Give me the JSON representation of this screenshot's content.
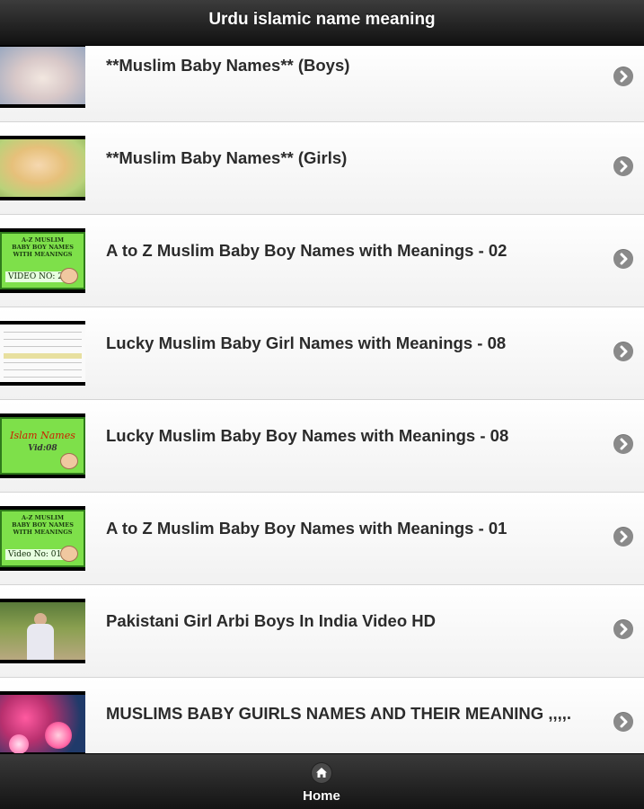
{
  "header": {
    "title": "Urdu islamic name meaning"
  },
  "items": [
    {
      "title": "**Muslim Baby Names** (Boys)",
      "thumb_icon": "sleeping-baby-thumbnail"
    },
    {
      "title": "**Muslim Baby Names** (Girls)",
      "thumb_icon": "baby-girl-thumbnail"
    },
    {
      "title": "A to Z Muslim Baby Boy Names with Meanings - 02",
      "thumb_icon": "green-title-card-thumbnail",
      "thumb_lines": [
        "A-Z MUSLIM",
        "BABY BOY NAMES",
        "WITH MEANINGS"
      ],
      "thumb_video": "VIDEO NO: 2"
    },
    {
      "title": "Lucky Muslim Baby Girl Names with Meanings - 08",
      "thumb_icon": "names-table-thumbnail"
    },
    {
      "title": "Lucky Muslim Baby Boy Names with Meanings - 08",
      "thumb_icon": "islam-names-card-thumbnail",
      "thumb_lines": [
        "Islam Names",
        "Vid:08"
      ]
    },
    {
      "title": "A to Z Muslim Baby Boy Names with Meanings - 01",
      "thumb_icon": "green-title-card-thumbnail",
      "thumb_lines": [
        "A-Z MUSLIM",
        "BABY BOY NAMES",
        "WITH MEANINGS"
      ],
      "thumb_video": "Video No: 01"
    },
    {
      "title": "Pakistani Girl Arbi Boys In India Video HD",
      "thumb_icon": "outdoor-people-thumbnail"
    },
    {
      "title": "MUSLIMS BABY GUIRLS NAMES AND THEIR MEANING ,,,,.",
      "thumb_icon": "flower-card-thumbnail"
    }
  ],
  "footer": {
    "home_label": "Home"
  },
  "colors": {
    "header_bg": "#1c1c1c",
    "list_bg": "#f4f4f4",
    "title_text": "#2b2b2b",
    "arrow_circle": "#8a8a8a",
    "thumb_green": "#7ee04a"
  }
}
